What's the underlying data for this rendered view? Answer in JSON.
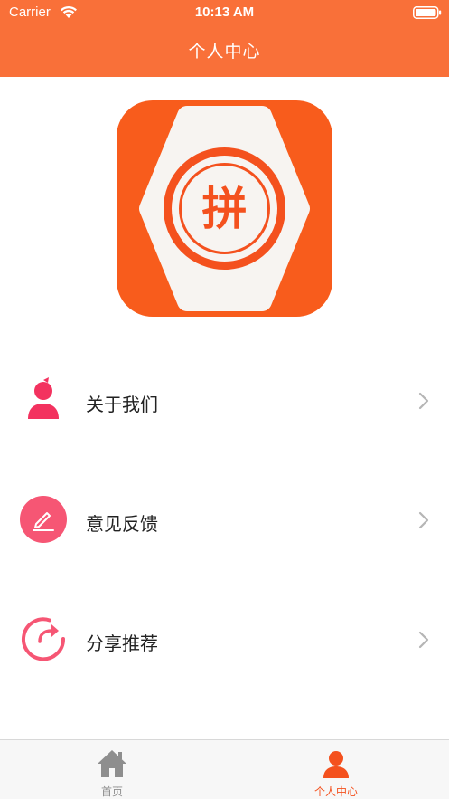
{
  "status_bar": {
    "carrier": "Carrier",
    "time": "10:13 AM"
  },
  "header": {
    "title": "个人中心"
  },
  "logo": {
    "glyph": "拼"
  },
  "menu": {
    "items": [
      {
        "label": "关于我们",
        "icon": "person-icon"
      },
      {
        "label": "意见反馈",
        "icon": "edit-icon"
      },
      {
        "label": "分享推荐",
        "icon": "share-icon"
      }
    ]
  },
  "tabbar": {
    "tabs": [
      {
        "label": "首页",
        "icon": "home-icon",
        "selected": false
      },
      {
        "label": "个人中心",
        "icon": "profile-icon",
        "selected": true
      }
    ]
  },
  "colors": {
    "header_bg": "#f97039",
    "accent": "#f4511e",
    "icon_pink": "#f3325f",
    "tab_inactive": "#8e8e8e"
  }
}
